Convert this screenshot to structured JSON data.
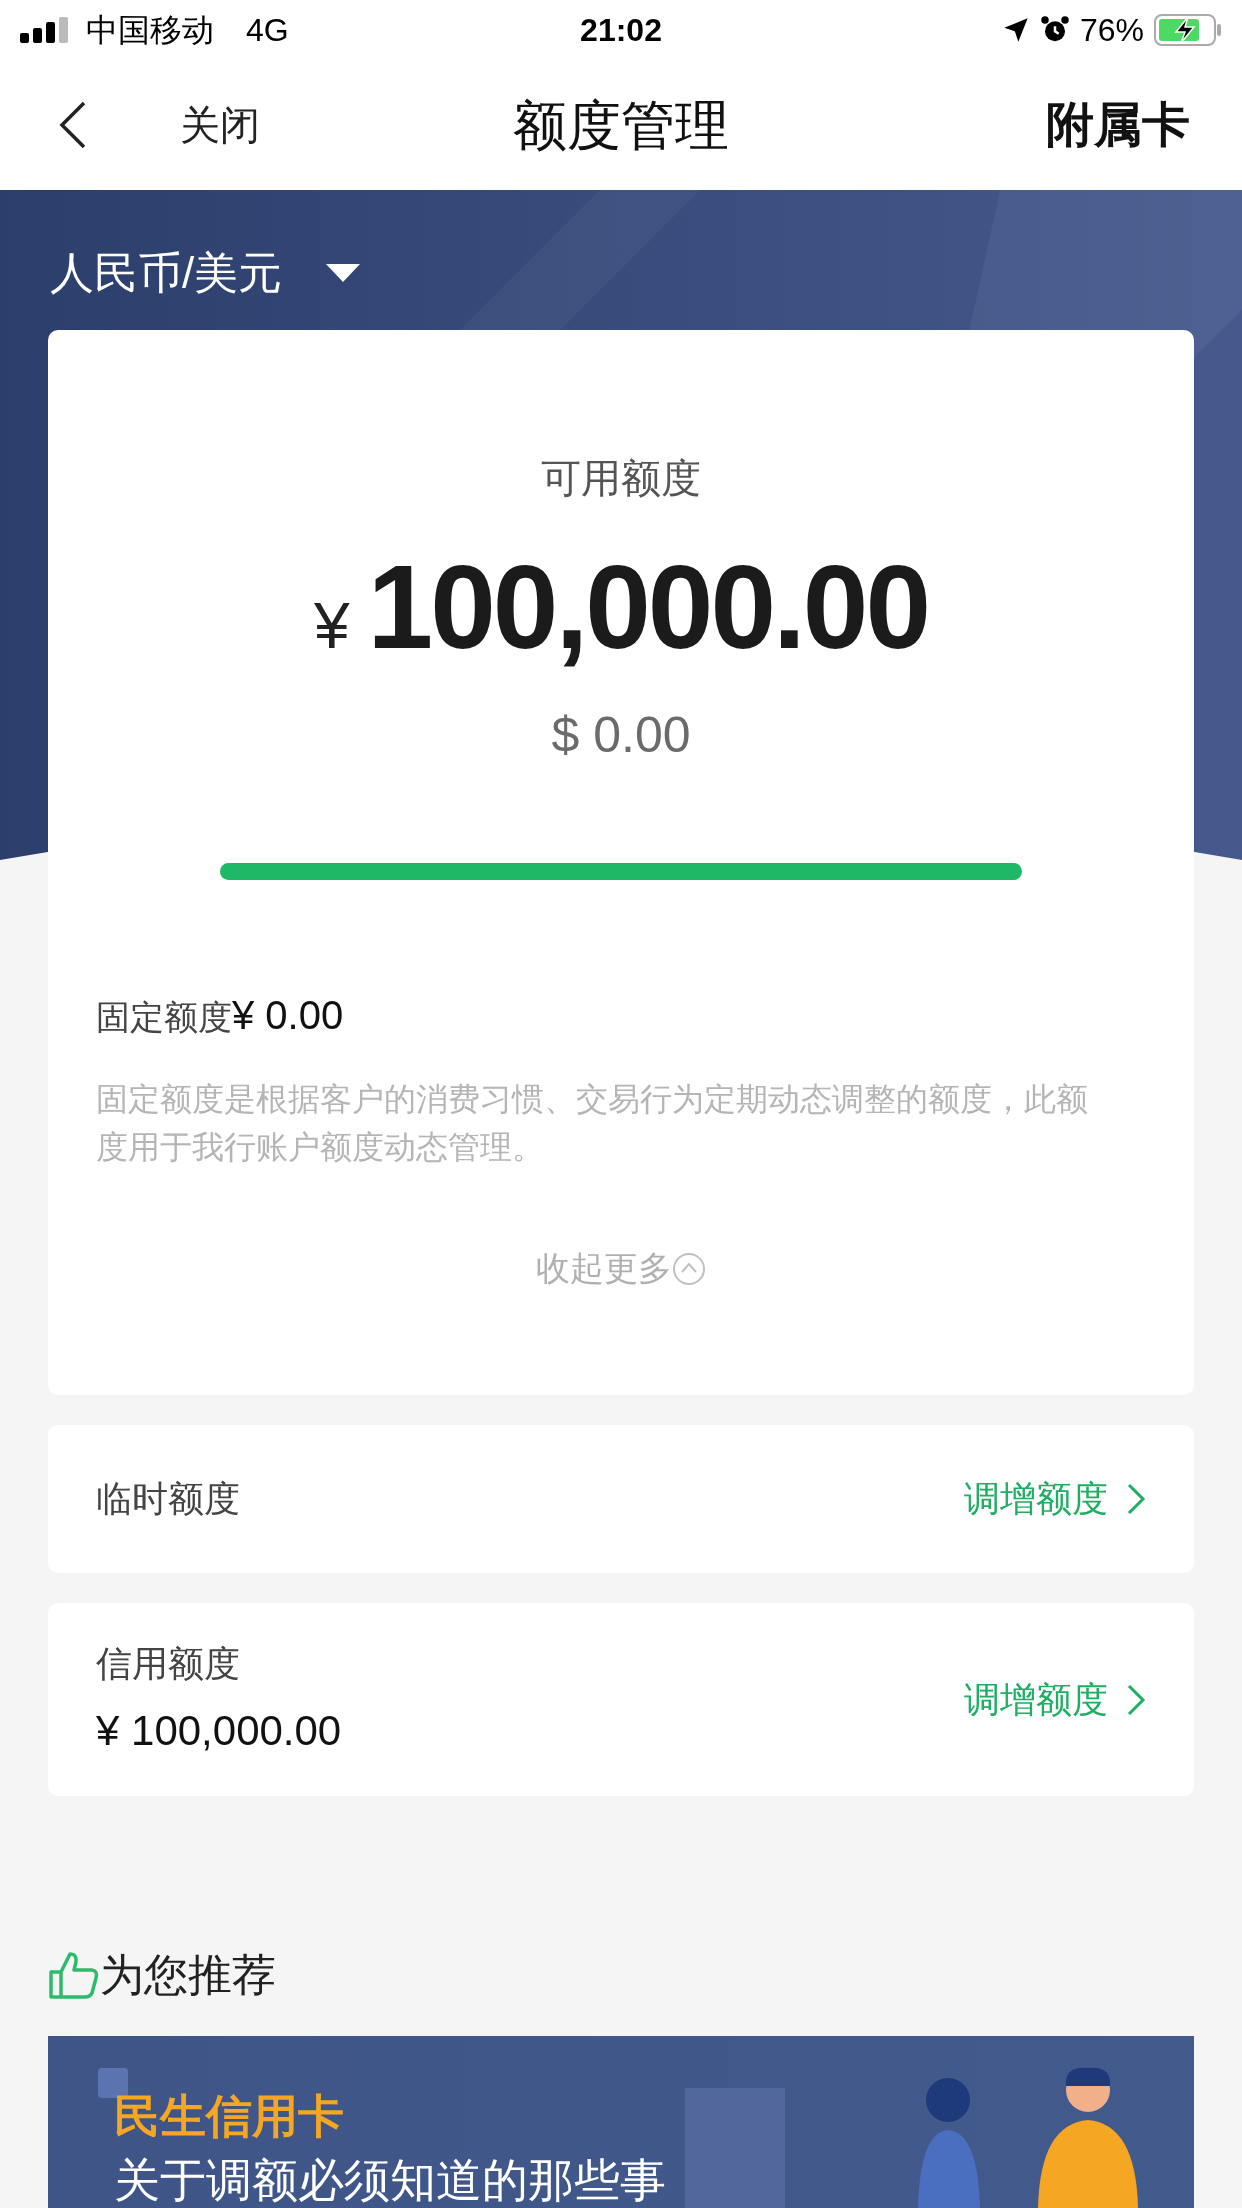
{
  "status_bar": {
    "carrier": "中国移动",
    "network": "4G",
    "time": "21:02",
    "battery": "76%"
  },
  "nav": {
    "close": "关闭",
    "title": "额度管理",
    "action": "附属卡"
  },
  "currency_selector": {
    "label": "人民币/美元"
  },
  "available": {
    "label": "可用额度",
    "currency_symbol": "¥",
    "amount": "100,000.00",
    "amount_usd": "$ 0.00",
    "level": 1,
    "fixed_label": "固定额度",
    "fixed_value": "¥ 0.00",
    "description": "固定额度是根据客户的消费习惯、交易行为定期动态调整的额度，此额度用于我行账户额度动态管理。",
    "collapse": "收起更多"
  },
  "limits": [
    {
      "label": "临时额度",
      "action": "调增额度"
    },
    {
      "label": "信用额度",
      "value": "¥ 100,000.00",
      "action": "调增额度"
    }
  ],
  "recommend": {
    "title": "为您推荐",
    "banner_brand": "民生信用卡",
    "banner_headline": "关于调额必须知道的那些事"
  }
}
